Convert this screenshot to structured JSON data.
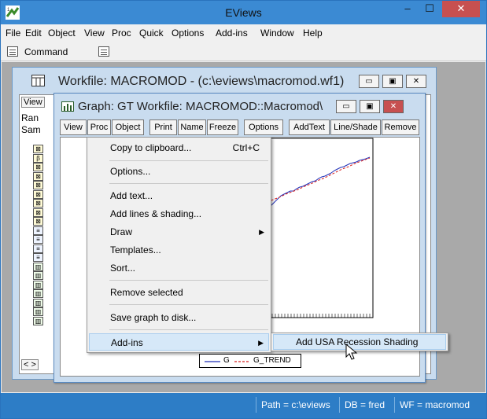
{
  "app": {
    "title": "EViews",
    "window_buttons": {
      "minimize": "–",
      "maximize": "☐",
      "close": "✕"
    }
  },
  "menubar": [
    "File",
    "Edit",
    "Object",
    "View",
    "Proc",
    "Quick",
    "Options",
    "Add-ins",
    "Window",
    "Help"
  ],
  "command_bar": {
    "label": "Command"
  },
  "workfile_window": {
    "title": "Workfile: MACROMOD - (c:\\eviews\\macromod.wf1)",
    "toolbar_partial": "View",
    "range_partial": "Ran",
    "sample_partial": "Sam",
    "object_icons": [
      "series",
      "beta",
      "series",
      "series",
      "series",
      "series",
      "series",
      "series",
      "series",
      "text",
      "text",
      "text",
      "text",
      "graph",
      "graph",
      "graph",
      "graph",
      "graph",
      "graph",
      "graph"
    ],
    "nav_partial": "< >"
  },
  "graph_window": {
    "title": "Graph: GT   Workfile: MACROMOD::Macromod\\",
    "toolbar": [
      "View",
      "Proc",
      "Object",
      "Print",
      "Name",
      "Freeze",
      "Options",
      "AddText",
      "Line/Shade",
      "Remove"
    ],
    "legend": {
      "series1": "G",
      "series2": "G_TREND"
    }
  },
  "context_menu": {
    "items": [
      {
        "label": "Copy to clipboard...",
        "shortcut": "Ctrl+C"
      },
      {
        "label": "Options..."
      },
      {
        "label": "Add text..."
      },
      {
        "label": "Add lines & shading..."
      },
      {
        "label": "Draw",
        "submenu": true
      },
      {
        "label": "Templates..."
      },
      {
        "label": "Sort..."
      },
      {
        "label": "Remove selected"
      },
      {
        "label": "Save graph to disk..."
      },
      {
        "label": "Add-ins",
        "submenu": true,
        "highlighted": true
      }
    ],
    "submenu": {
      "label": "Add USA Recession Shading"
    }
  },
  "statusbar": {
    "path": "Path = c:\\eviews",
    "db": "DB = fred",
    "wf": "WF = macromod"
  },
  "colors": {
    "titlebar": "#3b8ad3",
    "close_button": "#c75050",
    "workfile_bg": "#c9dcef",
    "menu_highlight": "#d6e8f8",
    "series_g": "#1f2fb8",
    "series_trend": "#d81e1e"
  }
}
